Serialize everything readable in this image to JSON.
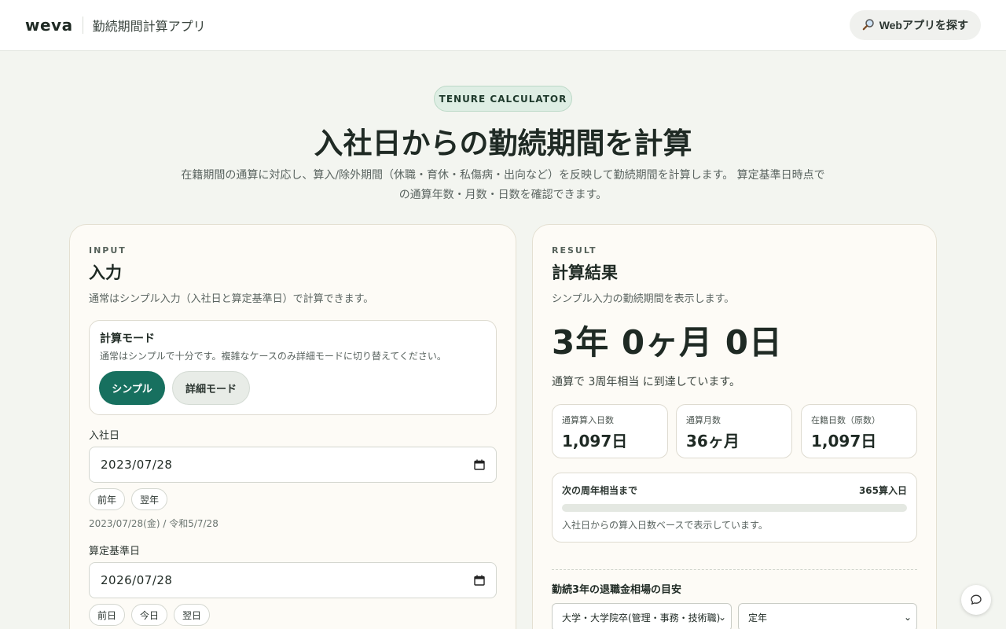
{
  "header": {
    "logo": "weva",
    "app_title": "勤続期間計算アプリ",
    "find_apps_label": "Webアプリを探す",
    "find_apps_icon": "magnifier-icon"
  },
  "hero": {
    "badge": "TENURE CALCULATOR",
    "title": "入社日からの勤続期間を計算",
    "description_line1": "在籍期間の通算に対応し、算入/除外期間（休職・育休・私傷病・出向など）を反映して勤続期間を計算します。 算定基準日時点で",
    "description_line2": "の通算年数・月数・日数を確認できます。"
  },
  "input": {
    "eyebrow": "INPUT",
    "title": "入力",
    "description": "通常はシンプル入力（入社日と算定基準日）で計算できます。",
    "mode": {
      "title": "計算モード",
      "description": "通常はシンプルで十分です。複雑なケースのみ詳細モードに切り替えてください。",
      "simple_label": "シンプル",
      "detail_label": "詳細モード",
      "selected": "シンプル"
    },
    "join_date": {
      "label": "入社日",
      "value": "2023/07/28",
      "prev_label": "前年",
      "next_label": "翌年",
      "note": "2023/07/28(金) / 令和5/7/28"
    },
    "base_date": {
      "label": "算定基準日",
      "value": "2026/07/28",
      "prev_label": "前日",
      "today_label": "今日",
      "next_label": "翌日"
    }
  },
  "result": {
    "eyebrow": "RESULT",
    "title": "計算結果",
    "description": "シンプル入力の勤続期間を表示します。",
    "tenure": "3年 0ヶ月 0日",
    "note": "通算で 3周年相当 に到達しています。",
    "stats": [
      {
        "label": "通算算入日数",
        "value": "1,097日"
      },
      {
        "label": "通算月数",
        "value": "36ヶ月"
      },
      {
        "label": "在籍日数（原数）",
        "value": "1,097日"
      }
    ],
    "next_anniversary": {
      "label": "次の周年相当まで",
      "value": "365算入日",
      "progress_fraction": 0,
      "note": "入社日からの算入日数ベースで表示しています。"
    },
    "severance": {
      "title": "勤続3年の退職金相場の目安",
      "education_selected": "大学・大学院卒(管理・事務・技術職)",
      "reason_selected": "定年"
    }
  },
  "colors": {
    "accent": "#17705f",
    "background": "#f3f5f0",
    "card": "#fdfbf6"
  },
  "chat_icon": "chat-bubble-icon"
}
